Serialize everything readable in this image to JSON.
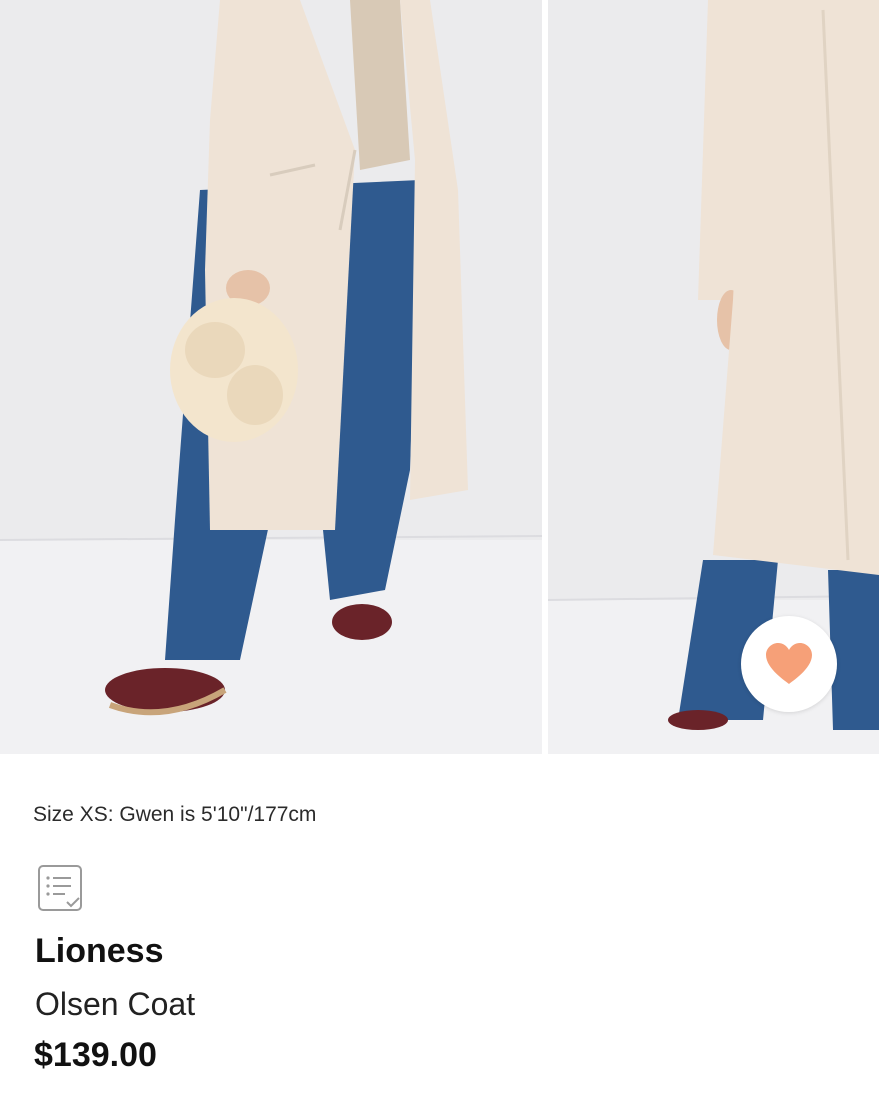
{
  "product": {
    "size_note": "Size XS: Gwen is 5'10\"/177cm",
    "brand": "Lioness",
    "name": "Olsen Coat",
    "price": "$139.00"
  },
  "icons": {
    "favorite": "heart-icon",
    "size_guide": "list-check-icon"
  },
  "colors": {
    "favorite_heart": "#f6a078",
    "coat": "#efe3d6",
    "denim": "#2f5a8f",
    "background": "#ececee"
  }
}
